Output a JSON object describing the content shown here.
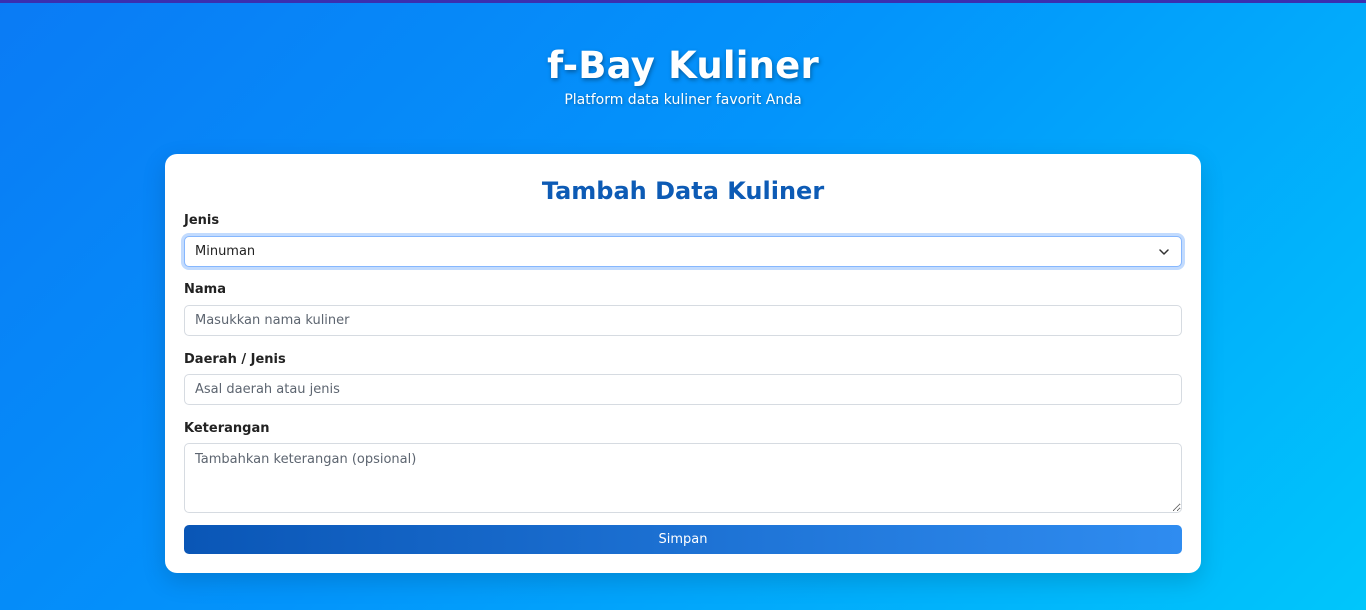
{
  "header": {
    "title": "f-Bay Kuliner",
    "subtitle": "Platform data kuliner favorit Anda"
  },
  "form": {
    "title": "Tambah Data Kuliner",
    "jenis": {
      "label": "Jenis",
      "selected": "Minuman",
      "icon": "chevron-down-icon"
    },
    "nama": {
      "label": "Nama",
      "value": "",
      "placeholder": "Masukkan nama kuliner"
    },
    "daerah": {
      "label": "Daerah / Jenis",
      "value": "",
      "placeholder": "Asal daerah atau jenis"
    },
    "keterangan": {
      "label": "Keterangan",
      "value": "",
      "placeholder": "Tambahkan keterangan (opsional)"
    },
    "submit_label": "Simpan"
  },
  "colors": {
    "accent": "#0d5bb5",
    "button_start": "#0a56b6",
    "button_end": "#2f8cf0",
    "background_start": "#0a7bf5",
    "background_end": "#00c6fb"
  }
}
